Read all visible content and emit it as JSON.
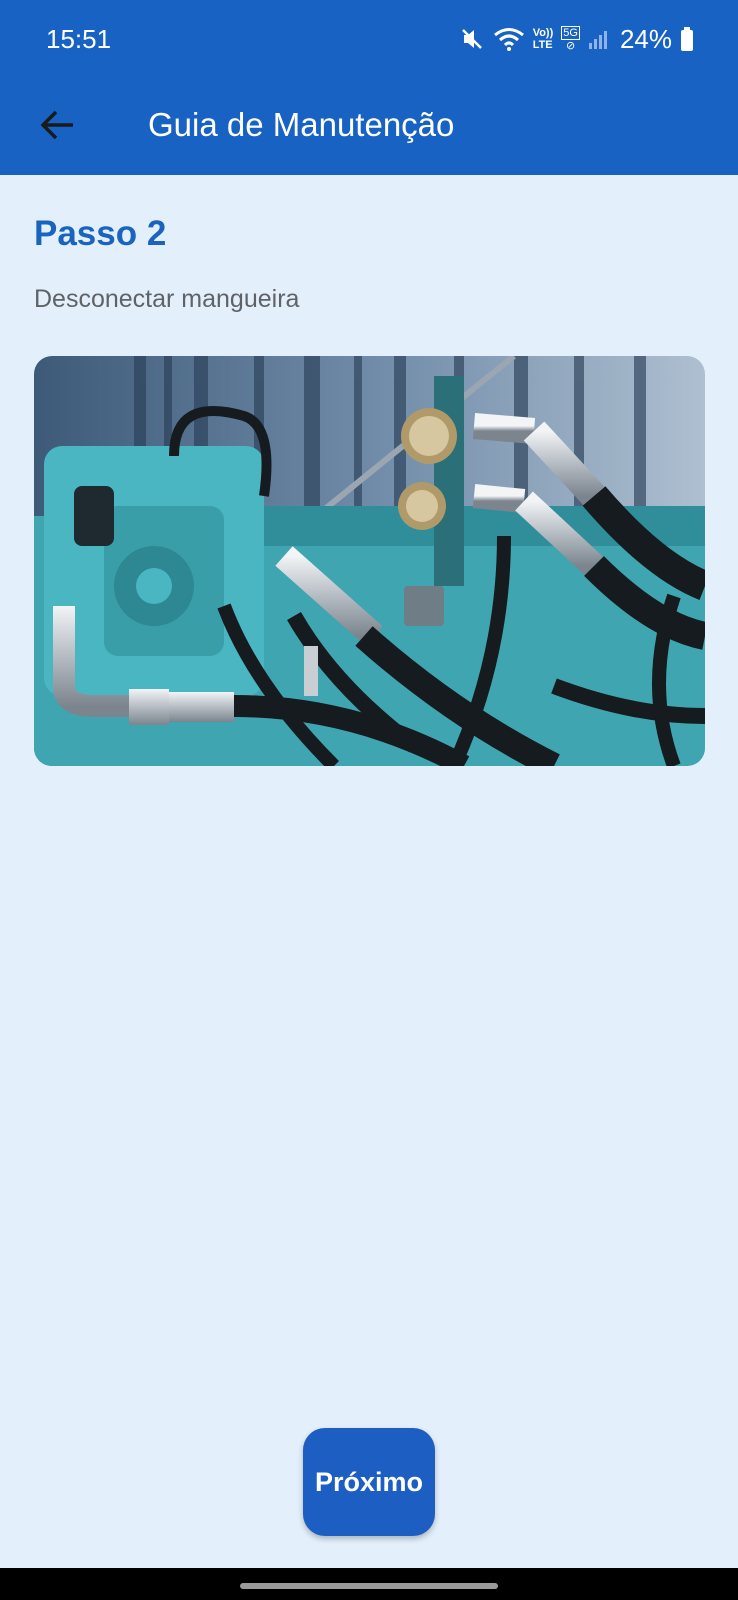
{
  "status_bar": {
    "time": "15:51",
    "battery": "24%",
    "network_label_top": "Vo))",
    "network_label_bottom": "LTE",
    "network_5g": "5G",
    "icons": [
      "mute-icon",
      "wifi-icon",
      "volte-icon",
      "5g-icon",
      "signal-icon",
      "battery-icon"
    ]
  },
  "app_bar": {
    "title": "Guia de Manutenção",
    "back_icon": "arrow-left-icon"
  },
  "step": {
    "title": "Passo 2",
    "description": "Desconectar mangueira",
    "image_alt": "hydraulic-machinery-photo"
  },
  "actions": {
    "next_label": "Próximo"
  },
  "colors": {
    "primary": "#1762c2",
    "background": "#e3f0fc",
    "title_text": "#1a63bf",
    "secondary_text": "#5f6368"
  }
}
